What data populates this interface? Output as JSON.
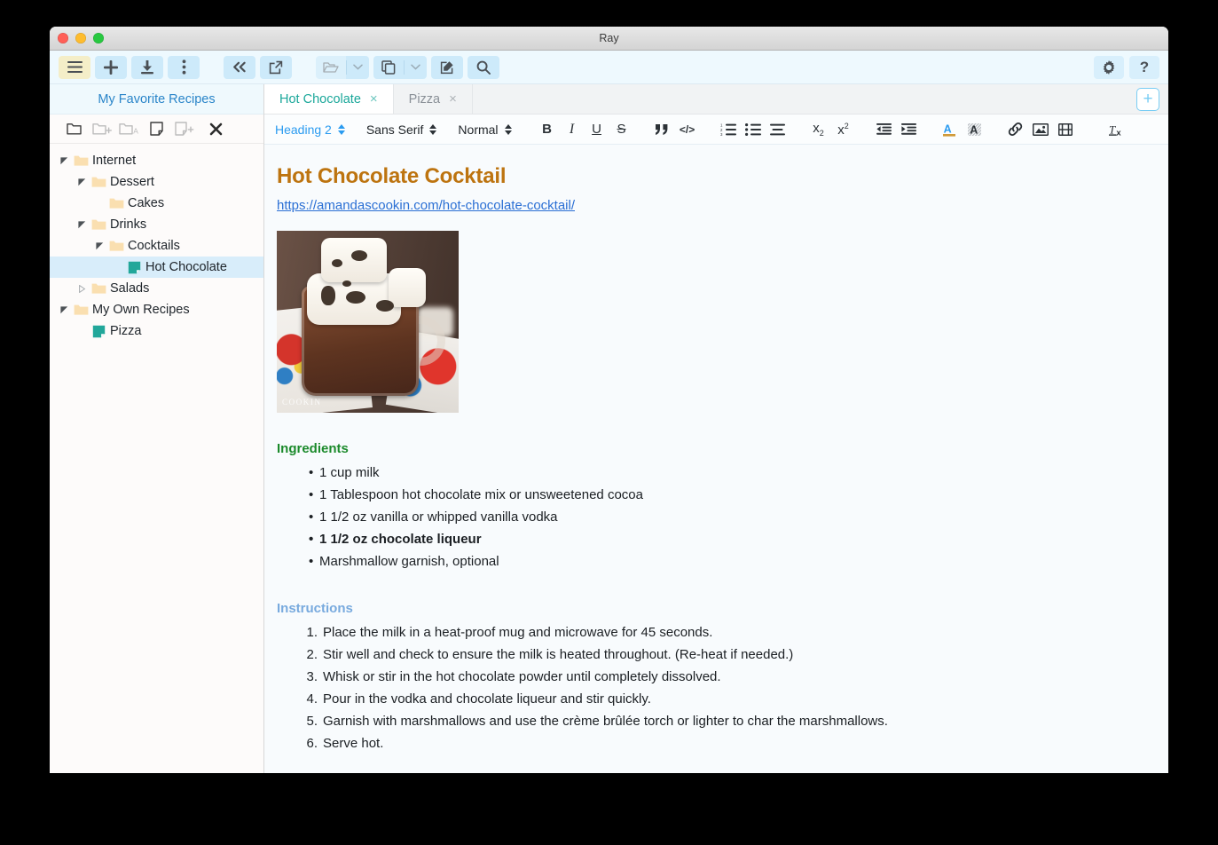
{
  "window": {
    "title": "Ray"
  },
  "toolbar": {
    "left": [
      {
        "name": "menu-button",
        "icon": "hamburger-icon",
        "state": "active"
      },
      {
        "name": "add-button",
        "icon": "plus-icon",
        "state": "normal"
      },
      {
        "name": "import-button",
        "icon": "download-icon",
        "state": "normal"
      },
      {
        "name": "more-button",
        "icon": "kebab-menu-icon",
        "state": "normal"
      }
    ],
    "nav": [
      {
        "name": "collapse-sidebar-button",
        "icon": "double-chevron-left-icon"
      },
      {
        "name": "open-external-button",
        "icon": "external-link-icon"
      }
    ],
    "actions": [
      {
        "name": "open-folder-button",
        "icon": "folder-open-icon",
        "caret": true,
        "dim": true
      },
      {
        "name": "duplicate-button",
        "icon": "copy-icon",
        "caret": true,
        "dim": false
      },
      {
        "name": "edit-note-button",
        "icon": "pencil-square-icon",
        "caret": false,
        "dim": false
      },
      {
        "name": "search-button",
        "icon": "search-icon",
        "caret": false,
        "dim": false
      }
    ],
    "right": [
      {
        "name": "settings-button",
        "icon": "gear-icon"
      },
      {
        "name": "help-button",
        "icon": "question-mark-icon"
      }
    ]
  },
  "sidebar": {
    "header": "My Favorite Recipes",
    "tools": [
      {
        "name": "new-folder-button",
        "icon": "folder-icon",
        "dim": false
      },
      {
        "name": "add-folder-button",
        "icon": "folder-plus-icon",
        "dim": true
      },
      {
        "name": "add-folder-alpha-button",
        "icon": "folder-a-icon",
        "dim": true
      },
      {
        "name": "new-note-button",
        "icon": "note-icon",
        "dim": false
      },
      {
        "name": "add-note-button",
        "icon": "note-plus-icon",
        "dim": true
      },
      {
        "name": "delete-button",
        "icon": "close-x-icon",
        "dim": false
      }
    ],
    "tree": [
      {
        "label": "Internet",
        "type": "folder",
        "depth": 0,
        "twisty": "expanded",
        "selected": false
      },
      {
        "label": "Dessert",
        "type": "folder",
        "depth": 1,
        "twisty": "expanded",
        "selected": false
      },
      {
        "label": "Cakes",
        "type": "folder",
        "depth": 2,
        "twisty": "none",
        "selected": false
      },
      {
        "label": "Drinks",
        "type": "folder",
        "depth": 1,
        "twisty": "expanded",
        "selected": false
      },
      {
        "label": "Cocktails",
        "type": "folder",
        "depth": 2,
        "twisty": "expanded",
        "selected": false
      },
      {
        "label": "Hot Chocolate",
        "type": "note",
        "depth": 3,
        "twisty": "none",
        "selected": true
      },
      {
        "label": "Salads",
        "type": "folder",
        "depth": 1,
        "twisty": "collapsed",
        "selected": false
      },
      {
        "label": "My Own Recipes",
        "type": "folder",
        "depth": 0,
        "twisty": "expanded",
        "selected": false
      },
      {
        "label": "Pizza",
        "type": "note",
        "depth": 1,
        "twisty": "none",
        "selected": false
      }
    ]
  },
  "tabs": {
    "items": [
      {
        "label": "Hot Chocolate",
        "active": true,
        "close": "×"
      },
      {
        "label": "Pizza",
        "active": false,
        "close": "×"
      }
    ],
    "new_tab_label": "+"
  },
  "format_bar": {
    "style_select": "Heading 2",
    "font_select": "Sans Serif",
    "size_select": "Normal",
    "buttons": [
      {
        "name": "bold-button",
        "icon": "bold-icon",
        "label": "B"
      },
      {
        "name": "italic-button",
        "icon": "italic-icon",
        "label": "I"
      },
      {
        "name": "underline-button",
        "icon": "underline-icon",
        "label": "U"
      },
      {
        "name": "strikethrough-button",
        "icon": "strikethrough-icon",
        "label": "S"
      },
      {
        "name": "blockquote-button",
        "icon": "quote-icon",
        "label": "”"
      },
      {
        "name": "code-button",
        "icon": "code-icon",
        "label": "</>"
      },
      {
        "name": "ordered-list-button",
        "icon": "ordered-list-icon",
        "label": ""
      },
      {
        "name": "bullet-list-button",
        "icon": "bullet-list-icon",
        "label": ""
      },
      {
        "name": "align-button",
        "icon": "align-icon",
        "label": ""
      },
      {
        "name": "subscript-button",
        "icon": "subscript-icon",
        "label": "x₂"
      },
      {
        "name": "superscript-button",
        "icon": "superscript-icon",
        "label": "x²"
      },
      {
        "name": "outdent-button",
        "icon": "outdent-icon",
        "label": ""
      },
      {
        "name": "indent-button",
        "icon": "indent-icon",
        "label": ""
      },
      {
        "name": "text-color-button",
        "icon": "text-color-icon",
        "label": "A"
      },
      {
        "name": "highlight-button",
        "icon": "highlight-icon",
        "label": "A"
      },
      {
        "name": "insert-link-button",
        "icon": "link-icon",
        "label": ""
      },
      {
        "name": "insert-image-button",
        "icon": "image-icon",
        "label": ""
      },
      {
        "name": "insert-video-button",
        "icon": "film-icon",
        "label": ""
      },
      {
        "name": "clear-format-button",
        "icon": "clear-format-icon",
        "label": "Tx"
      }
    ]
  },
  "document": {
    "title": "Hot Chocolate Cocktail",
    "url": "https://amandascookin.com/hot-chocolate-cocktail/",
    "image_alt": "hot-chocolate-cocktail-photo",
    "image_watermark": "COOKIN",
    "ingredients_heading": "Ingredients",
    "ingredients": [
      {
        "text": "1 cup milk",
        "bold": false
      },
      {
        "text": "1 Tablespoon hot chocolate mix or unsweetened cocoa",
        "bold": false
      },
      {
        "text": "1 1/2 oz vanilla or whipped vanilla vodka",
        "bold": false
      },
      {
        "text": "1 1/2 oz chocolate liqueur",
        "bold": true
      },
      {
        "text": "Marshmallow garnish, optional",
        "bold": false
      }
    ],
    "instructions_heading": "Instructions",
    "instructions": [
      "Place the milk in a heat-proof mug and microwave for 45 seconds.",
      "Stir well and check to ensure the milk is heated throughout. (Re-heat if needed.)",
      "Whisk or stir in the hot chocolate powder until completely dissolved.",
      "Pour in the vodka and chocolate liqueur and stir quickly.",
      "Garnish with marshmallows and use the crème brûlée torch or lighter to char the marshmallows.",
      "Serve hot."
    ]
  },
  "colors": {
    "title_orange": "#bd7410",
    "link_blue": "#2a6fd4",
    "ingredients_green": "#1b8a2b",
    "instructions_blue": "#78aade",
    "active_tab_teal": "#1aa79a",
    "sidebar_header_blue": "#2a85c9",
    "toolbar_blue": "#cdeafa",
    "active_toolbar_yellow": "#f4eec8",
    "selection_blue": "#d8edfa",
    "note_icon_teal": "#22a79a",
    "folder_icon_tan": "#fadfb0"
  }
}
